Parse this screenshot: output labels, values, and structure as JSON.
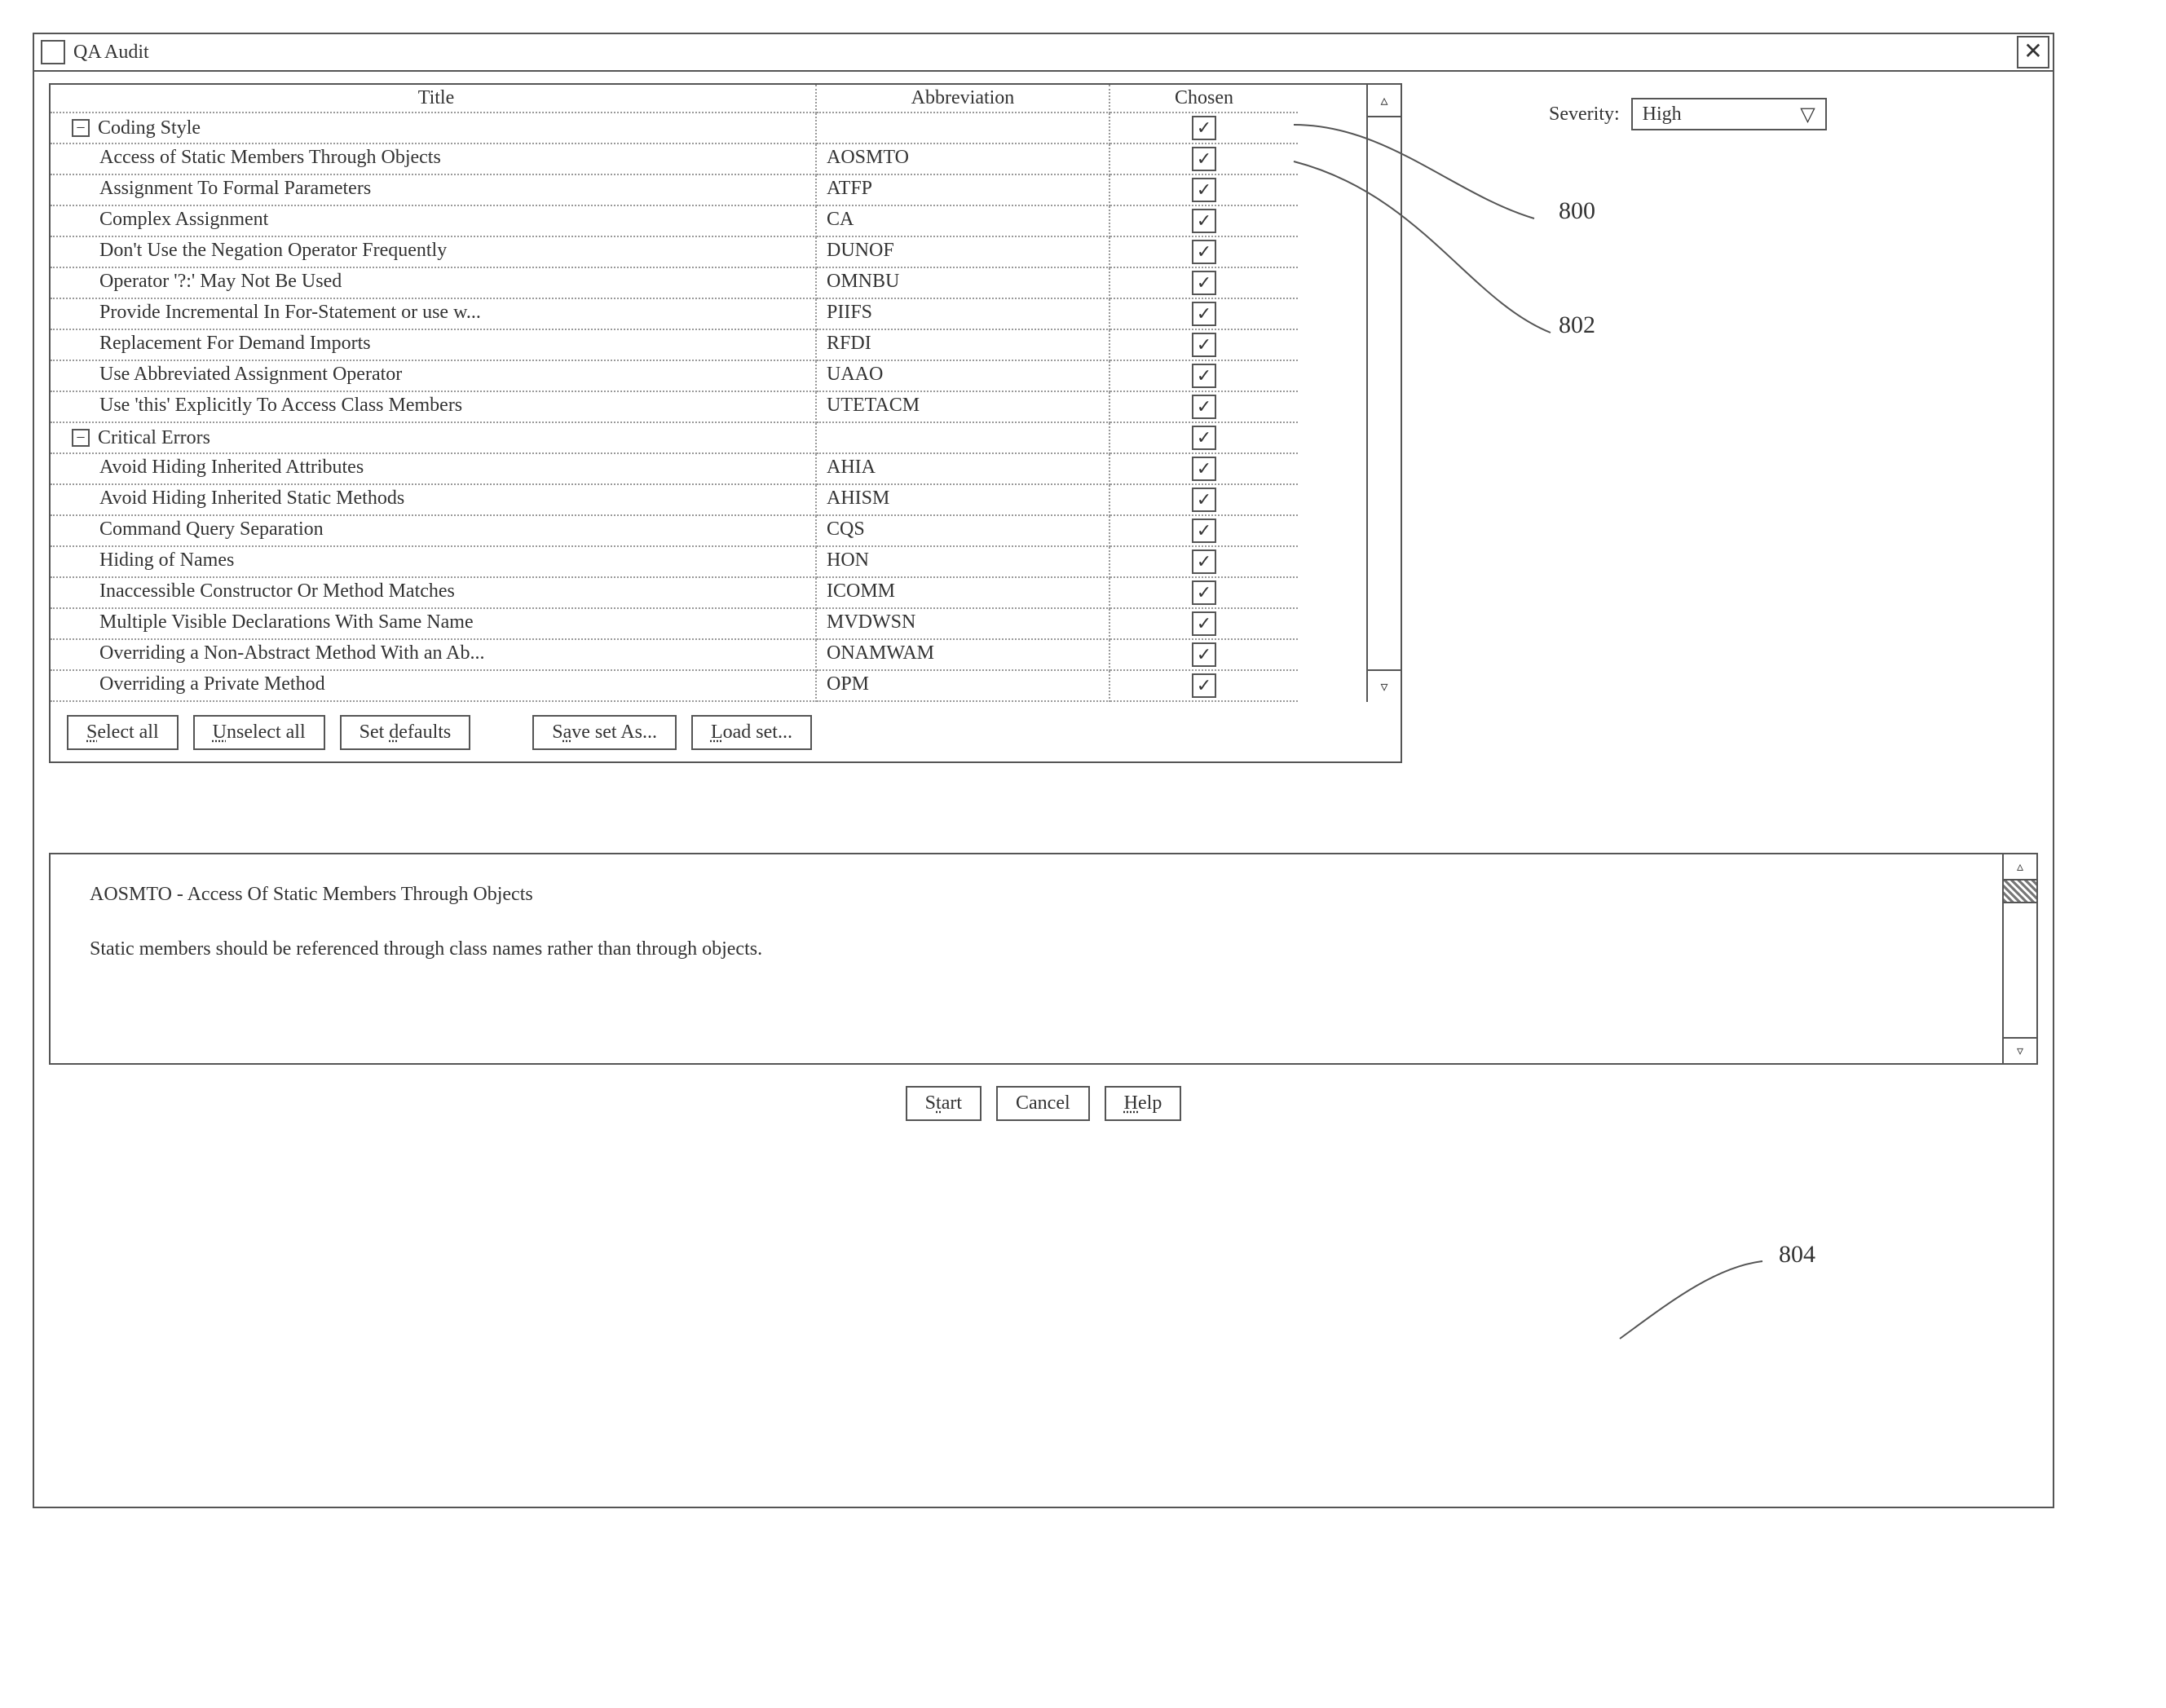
{
  "window": {
    "title": "QA Audit"
  },
  "severity": {
    "label": "Severity:",
    "value": "High"
  },
  "columns": {
    "title": "Title",
    "abbr": "Abbreviation",
    "chosen": "Chosen"
  },
  "groups": [
    {
      "name": "Coding Style",
      "chosen": true,
      "items": [
        {
          "title": "Access of Static Members Through Objects",
          "abbr": "AOSMTO",
          "chosen": true
        },
        {
          "title": "Assignment To Formal Parameters",
          "abbr": "ATFP",
          "chosen": true
        },
        {
          "title": "Complex Assignment",
          "abbr": "CA",
          "chosen": true
        },
        {
          "title": "Don't Use the Negation Operator Frequently",
          "abbr": "DUNOF",
          "chosen": true
        },
        {
          "title": "Operator '?:' May Not Be Used",
          "abbr": "OMNBU",
          "chosen": true
        },
        {
          "title": "Provide Incremental In For-Statement or use w...",
          "abbr": "PIIFS",
          "chosen": true
        },
        {
          "title": "Replacement For Demand Imports",
          "abbr": "RFDI",
          "chosen": true
        },
        {
          "title": "Use Abbreviated Assignment Operator",
          "abbr": "UAAO",
          "chosen": true
        },
        {
          "title": "Use 'this' Explicitly To Access Class Members",
          "abbr": "UTETACM",
          "chosen": true
        }
      ]
    },
    {
      "name": "Critical Errors",
      "chosen": true,
      "items": [
        {
          "title": "Avoid Hiding Inherited Attributes",
          "abbr": "AHIA",
          "chosen": true
        },
        {
          "title": "Avoid Hiding Inherited Static Methods",
          "abbr": "AHISM",
          "chosen": true
        },
        {
          "title": "Command Query Separation",
          "abbr": "CQS",
          "chosen": true
        },
        {
          "title": "Hiding of Names",
          "abbr": "HON",
          "chosen": true
        },
        {
          "title": "Inaccessible Constructor Or Method Matches",
          "abbr": "ICOMM",
          "chosen": true
        },
        {
          "title": "Multiple Visible Declarations With Same Name",
          "abbr": "MVDWSN",
          "chosen": true
        },
        {
          "title": "Overriding a Non-Abstract Method With an Ab...",
          "abbr": "ONAMWAM",
          "chosen": true
        },
        {
          "title": "Overriding a Private Method",
          "abbr": "OPM",
          "chosen": true
        }
      ]
    }
  ],
  "buttons": {
    "select_all": "Select all",
    "unselect_all": "Unselect all",
    "set_defaults": "Set defaults",
    "save_set_as": "Save set As...",
    "load_set": "Load set...",
    "start": "Start",
    "cancel": "Cancel",
    "help": "Help"
  },
  "detail": {
    "heading": "AOSMTO - Access Of Static Members Through Objects",
    "body": "Static members should be referenced through class names rather than through objects."
  },
  "callouts": {
    "a": "800",
    "b": "802",
    "c": "804"
  }
}
